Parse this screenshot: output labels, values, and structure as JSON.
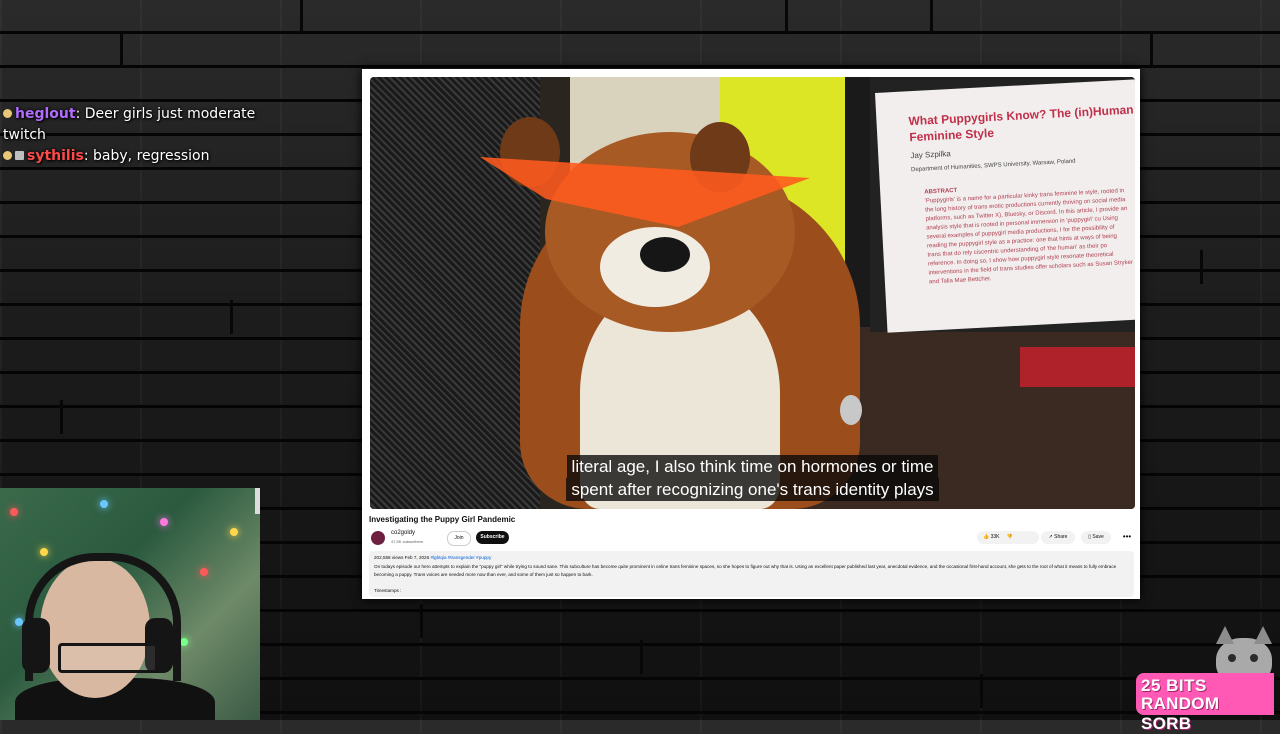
{
  "chat": {
    "messages": [
      {
        "user": "heglout",
        "text": ": Deer girls just moderate twitch"
      },
      {
        "user": "sythilis",
        "text": ": baby, regression"
      }
    ]
  },
  "video": {
    "subtitle_line1": "literal age, I also think time on hormones or time",
    "subtitle_line2": "spent after recognizing one's trans identity plays",
    "paper": {
      "title": "What Puppygirls Know? The (in)Human Feminine Style",
      "author": "Jay Szpilka",
      "department": "Department of Humanities, SWPS University, Warsaw, Poland",
      "abstract_heading": "ABSTRACT",
      "abstract": "'Puppygirls' is a name for a particular kinky trans feminine le style, rooted in the long history of trans erotic productions currently thriving on social media platforms, such as Twitter X), Bluesky, or Discord. In this article, I provide an analysis style that is rooted in personal immersion in 'puppygirl' cu Using several examples of puppygirl media productions, I for the possibility of reading the puppygirl style as a practice: one that hints at ways of being trans that do rely ciscentric understanding of 'the human' as their po reference. In doing so, I show how puppygirl style resonate theoretical interventions in the field of trans studies offer scholars such as Susan Stryker and Talia Mae Bettcher."
    }
  },
  "youtube": {
    "title": "Investigating the Puppy Girl Pandemic",
    "channel_name": "co2goldy",
    "channel_subs": "47.5K subscribers",
    "join_label": "Join",
    "subscribe_label": "Subscribe",
    "likes": "33K",
    "share_label": "Share",
    "save_label": "Save",
    "more_label": "•••",
    "views_date": "202,558 views  Feb 7, 2026",
    "tags": "#lgbtqia #transgender #puppy",
    "description": "On todays episode our hero attempts to explain the \"puppy girl\" while trying to sound sane. This subculture has become quite prominent in online trans feminine spaces, so she hopes to figure out why that is. Using an excellent paper published last year, anecdotal evidence, and the occasional first-hand account, she gets to the root of what it means to fully embrace becoming a puppy. Trans voices are needed more now than ever, and some of them just so happen to bark.",
    "timestamps_label": "Timestamps :"
  },
  "bits_goal": {
    "count": "25 BITS",
    "name": "RANDOM SORB"
  },
  "colors": {
    "user1": "#b26bff",
    "user2": "#ff4a4a",
    "bits_bg": "#ff59b5",
    "paper_title": "#c0304a",
    "subscribe_bg": "#0f0f0f"
  }
}
